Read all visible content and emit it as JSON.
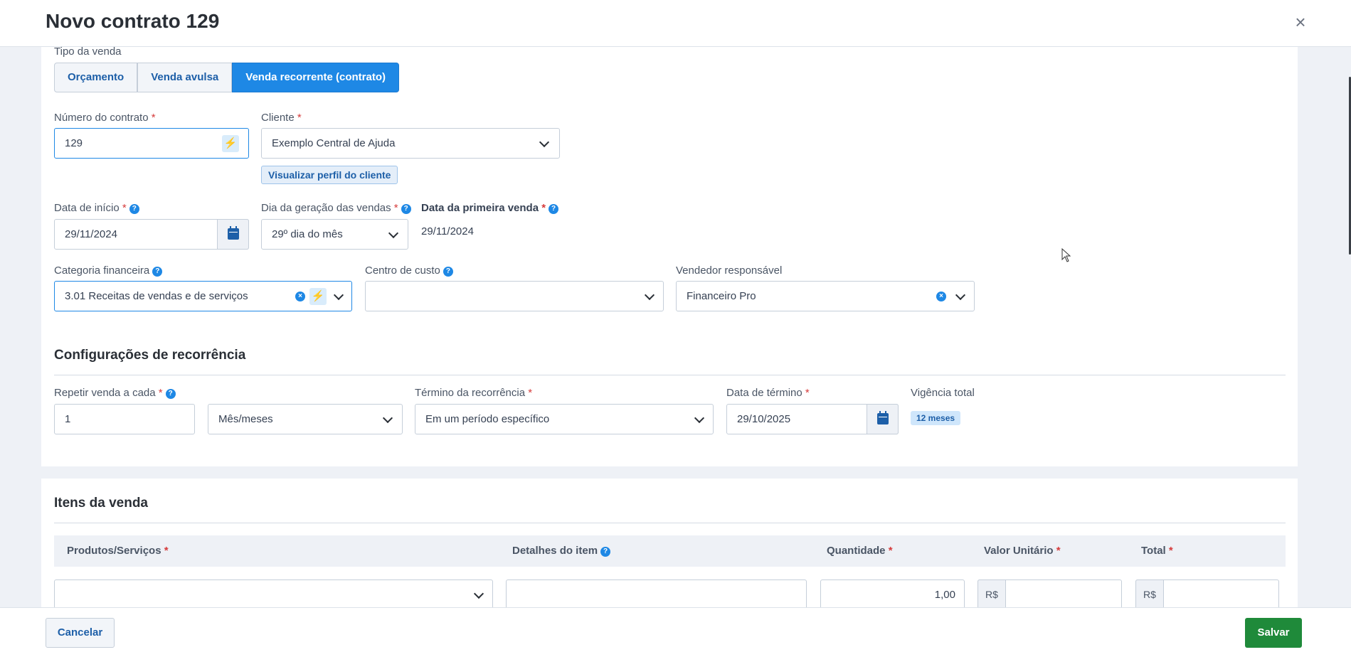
{
  "header": {
    "title": "Novo contrato 129",
    "close_icon": "close-icon"
  },
  "sale_type": {
    "label": "Tipo da venda",
    "options": [
      "Orçamento",
      "Venda avulsa",
      "Venda recorrente (contrato)"
    ],
    "selected": "Venda recorrente (contrato)"
  },
  "contract_number": {
    "label": "Número do contrato",
    "required": "*",
    "value": "129"
  },
  "client": {
    "label": "Cliente",
    "required": "*",
    "value": "Exemplo Central de Ajuda",
    "profile_button": "Visualizar perfil do cliente"
  },
  "start_date": {
    "label": "Data de início",
    "required": "*",
    "value": "29/11/2024"
  },
  "generation_day": {
    "label": "Dia da geração das vendas",
    "required": "*",
    "value": "29º dia do mês"
  },
  "first_sale": {
    "label": "Data da primeira venda",
    "required": "*",
    "value": "29/11/2024"
  },
  "category": {
    "label": "Categoria financeira",
    "value": "3.01 Receitas de vendas e de serviços"
  },
  "cost_center": {
    "label": "Centro de custo",
    "value": ""
  },
  "seller": {
    "label": "Vendedor responsável",
    "value": "Financeiro Pro"
  },
  "recurrence": {
    "title": "Configurações de recorrência",
    "repeat_label": "Repetir venda a cada",
    "repeat_required": "*",
    "repeat_value": "1",
    "unit_value": "Mês/meses",
    "end_label": "Término da recorrência",
    "end_required": "*",
    "end_value": "Em um período específico",
    "end_date_label": "Data de término",
    "end_date_required": "*",
    "end_date_value": "29/10/2025",
    "total_label": "Vigência total",
    "total_badge": "12 meses"
  },
  "items": {
    "title": "Itens da venda",
    "columns": [
      {
        "label": "Produtos/Serviços",
        "required": "*"
      },
      {
        "label": "Detalhes do item",
        "required": ""
      },
      {
        "label": "Quantidade",
        "required": "*"
      },
      {
        "label": "Valor Unitário",
        "required": "*"
      },
      {
        "label": "Total",
        "required": "*"
      }
    ],
    "row": {
      "product": "",
      "details": "",
      "quantity": "1,00",
      "unit_prefix": "R$",
      "unit_value": "",
      "total_prefix": "R$",
      "total_value": ""
    }
  },
  "footer": {
    "cancel": "Cancelar",
    "save": "Salvar"
  },
  "colors": {
    "primary": "#1e88e5",
    "save": "#1f8a3a",
    "required": "#d63b3b"
  }
}
